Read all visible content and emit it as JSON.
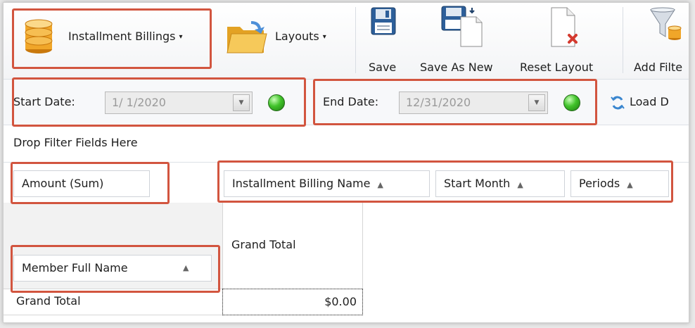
{
  "ribbon": {
    "installment_billings_label": "Installment Billings",
    "layouts_label": "Layouts",
    "save_label": "Save",
    "save_as_new_label": "Save As New",
    "reset_layout_label": "Reset Layout",
    "add_filter_label": "Add Filte",
    "dropdown_caret": "▾"
  },
  "dates": {
    "start_label": "Start Date:",
    "start_value": "1/ 1/2020",
    "end_label": "End Date:",
    "end_value": "12/31/2020",
    "load_label": "Load D",
    "status_color": "#41c32a"
  },
  "pivot": {
    "filter_area_text": "Drop Filter Fields Here",
    "data_field": "Amount (Sum)",
    "column_fields": [
      "Installment Billing Name",
      "Start Month",
      "Periods"
    ],
    "row_field": "Member Full Name",
    "sort_indicator": "▲",
    "column_grand_total": "Grand Total",
    "row_grand_total": "Grand Total",
    "grand_total_value": "$0.00"
  },
  "colors": {
    "highlight": "#d2553f"
  }
}
